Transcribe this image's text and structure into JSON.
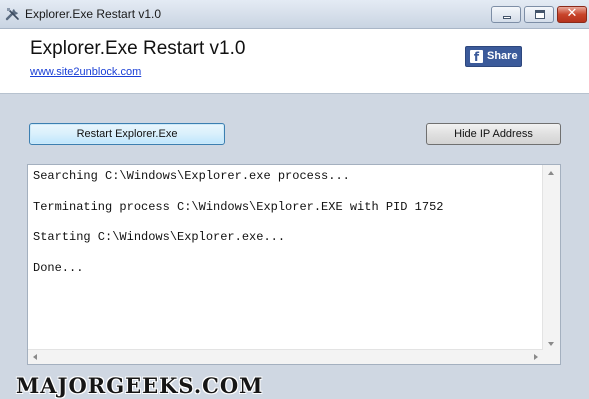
{
  "window": {
    "title": "Explorer.Exe Restart v1.0",
    "icon": "tools-icon"
  },
  "header": {
    "app_title": "Explorer.Exe Restart v1.0",
    "site_link": "www.site2unblock.com",
    "share_label": "Share",
    "share_logo": "f"
  },
  "buttons": {
    "restart_label": "Restart Explorer.Exe",
    "hide_ip_label": "Hide IP Address"
  },
  "log": {
    "lines": [
      "Searching C:\\Windows\\Explorer.exe process...",
      "Terminating process C:\\Windows\\Explorer.EXE with PID 1752",
      "Starting C:\\Windows\\Explorer.exe...",
      "Done..."
    ]
  },
  "watermark": "MAJORGEEKS.COM",
  "colors": {
    "facebook_blue": "#3b5a9a",
    "link_blue": "#1a3fd6",
    "close_red": "#c8442a"
  }
}
